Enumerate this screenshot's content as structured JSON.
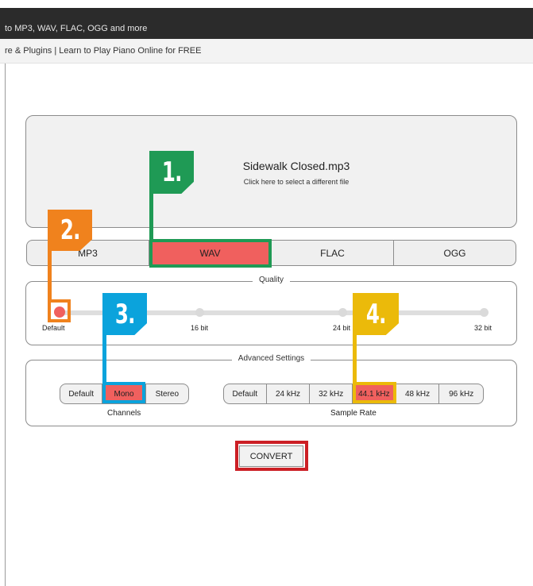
{
  "window": {
    "title": "to MP3, WAV, FLAC, OGG and more",
    "links": "re & Plugins |  Learn to Play Piano Online for FREE"
  },
  "file": {
    "name": "Sidewalk Closed.mp3",
    "hint": "Click here to select a different file"
  },
  "formats": {
    "items": [
      "MP3",
      "WAV",
      "FLAC",
      "OGG"
    ],
    "selected": "WAV"
  },
  "quality": {
    "legend": "Quality",
    "levels": [
      "Default",
      "16 bit",
      "24 bit",
      "32 bit"
    ],
    "selected": "Default"
  },
  "advanced": {
    "legend": "Advanced Settings",
    "channels": {
      "label": "Channels",
      "options": [
        "Default",
        "Mono",
        "Stereo"
      ],
      "selected": "Mono"
    },
    "sample_rate": {
      "label": "Sample Rate",
      "options": [
        "Default",
        "24 kHz",
        "32 kHz",
        "44.1 kHz",
        "48 kHz",
        "96 kHz"
      ],
      "selected": "44.1 kHz"
    }
  },
  "convert_label": "CONVERT",
  "callouts": [
    "1.",
    "2.",
    "3.",
    "4."
  ],
  "colors": {
    "accent_selected": "#f0605e",
    "callout_1": "#1f9a55",
    "callout_2": "#f0821d",
    "callout_3": "#0ba3dc",
    "callout_4": "#ebba0a",
    "convert_highlight": "#cc1f25"
  }
}
